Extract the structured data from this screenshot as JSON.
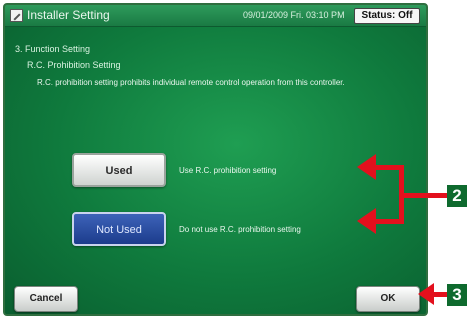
{
  "window": {
    "title": "Installer Setting",
    "datetime": "09/01/2009 Fri. 03:10 PM",
    "status": "Status: Off"
  },
  "header": {
    "section": "3. Function Setting",
    "subsection": "R.C. Prohibition Setting",
    "description": "R.C. prohibition setting prohibits individual remote control operation from this controller."
  },
  "options": [
    {
      "label": "Used",
      "description": "Use R.C. prohibition setting"
    },
    {
      "label": "Not Used",
      "description": "Do not use R.C. prohibition setting"
    }
  ],
  "footer": {
    "cancel_label": "Cancel",
    "ok_label": "OK"
  },
  "callouts": {
    "two": "2",
    "three": "3"
  },
  "colors": {
    "background": "#117d40",
    "selected_button": "#2b4fa6",
    "arrow": "#e3101d",
    "callout_box": "#0e6a2e"
  },
  "icons": {
    "app": "installer-app-icon"
  }
}
